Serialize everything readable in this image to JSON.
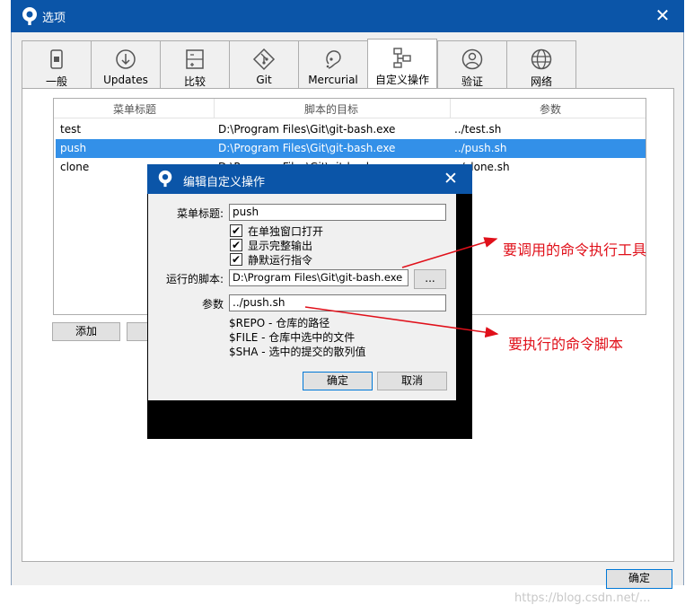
{
  "window": {
    "title": "选项",
    "close_glyph": "✕"
  },
  "tabs": [
    {
      "label": "一般",
      "icon": "general-icon"
    },
    {
      "label": "Updates",
      "icon": "download-icon"
    },
    {
      "label": "比较",
      "icon": "compare-icon"
    },
    {
      "label": "Git",
      "icon": "git-icon"
    },
    {
      "label": "Mercurial",
      "icon": "mercurial-icon"
    },
    {
      "label": "自定义操作",
      "icon": "custom-actions-icon",
      "active": true
    },
    {
      "label": "验证",
      "icon": "user-icon"
    },
    {
      "label": "网络",
      "icon": "globe-icon"
    }
  ],
  "actions_table": {
    "columns": [
      "菜单标题",
      "脚本的目标",
      "参数"
    ],
    "rows": [
      {
        "title": "test",
        "script": "D:\\Program Files\\Git\\git-bash.exe",
        "params": "../test.sh"
      },
      {
        "title": "push",
        "script": "D:\\Program Files\\Git\\git-bash.exe",
        "params": "../push.sh",
        "selected": true
      },
      {
        "title": "clone",
        "script": "D:\\Program Files\\Git\\git-bash.exe",
        "params": "../clone.sh"
      }
    ]
  },
  "buttons": {
    "add": "添加",
    "ok_main": "确定"
  },
  "dialog": {
    "title": "编辑自定义操作",
    "close_glyph": "✕",
    "menu_title_label": "菜单标题:",
    "menu_title_value": "push",
    "checkboxes": [
      {
        "label": "在单独窗口打开",
        "checked": true
      },
      {
        "label": "显示完整输出",
        "checked": true
      },
      {
        "label": "静默运行指令",
        "checked": true
      }
    ],
    "script_label": "运行的脚本:",
    "script_value": "D:\\Program Files\\Git\\git-bash.exe",
    "browse_label": "...",
    "params_label": "参数",
    "params_value": "../push.sh",
    "help": [
      "$REPO - 仓库的路径",
      "$FILE - 仓库中选中的文件",
      "$SHA - 选中的提交的散列值"
    ],
    "ok": "确定",
    "cancel": "取消"
  },
  "annotations": {
    "tool": "要调用的命令执行工具",
    "script": "要执行的命令脚本",
    "color": "#e0101a"
  },
  "watermark": "https://blog.csdn.net/..."
}
